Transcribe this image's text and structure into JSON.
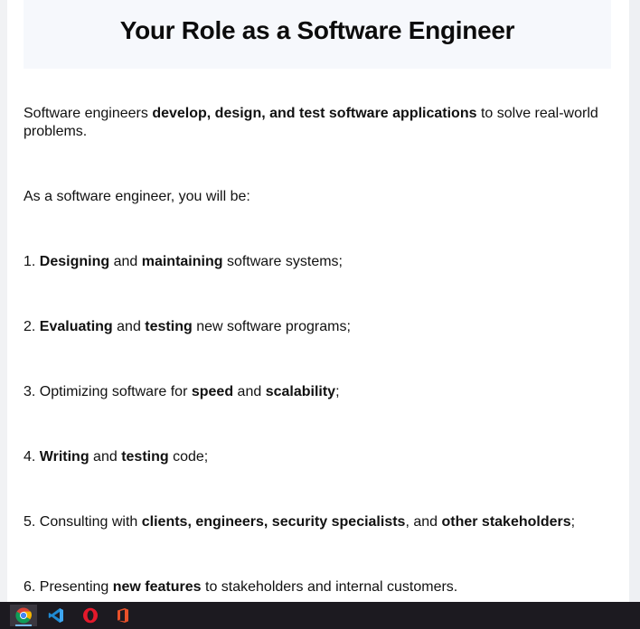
{
  "article": {
    "title": "Your Role as a Software Engineer",
    "intro": {
      "pre": "Software engineers ",
      "bold": "develop, design, and test software applications",
      "post": " to solve real-world problems."
    },
    "lead": "As a software engineer, you will be:",
    "items": [
      {
        "num": "1. ",
        "b1": "Designing",
        "t1": " and ",
        "b2": "maintaining",
        "t2": " software systems;"
      },
      {
        "num": "2. ",
        "b1": "Evaluating",
        "t1": " and ",
        "b2": "testing",
        "t2": " new software programs;"
      },
      {
        "num": "3. ",
        "t0": "Optimizing software for ",
        "b1": "speed",
        "t1": " and ",
        "b2": "scalability",
        "t2": ";"
      },
      {
        "num": "4. ",
        "b1": "Writing",
        "t1": " and ",
        "b2": "testing",
        "t2": " code;"
      },
      {
        "num": "5. ",
        "t0": "Consulting with ",
        "b1": "clients, engineers, security specialists",
        "t1": ", and ",
        "b2": "other stakeholders",
        "t2": ";"
      },
      {
        "num": "6. ",
        "t0": "Presenting ",
        "b1": "new features",
        "t1": " to stakeholders and internal customers."
      }
    ]
  },
  "taskbar": {
    "apps": [
      {
        "name": "Google Chrome",
        "icon": "chrome-icon",
        "active": true
      },
      {
        "name": "Visual Studio Code",
        "icon": "vscode-icon",
        "active": false
      },
      {
        "name": "Opera",
        "icon": "opera-icon",
        "active": false
      },
      {
        "name": "Microsoft Office",
        "icon": "office-icon",
        "active": false
      }
    ],
    "colors": {
      "background": "#1c1a20",
      "active_indicator": "#76b9ed"
    }
  }
}
